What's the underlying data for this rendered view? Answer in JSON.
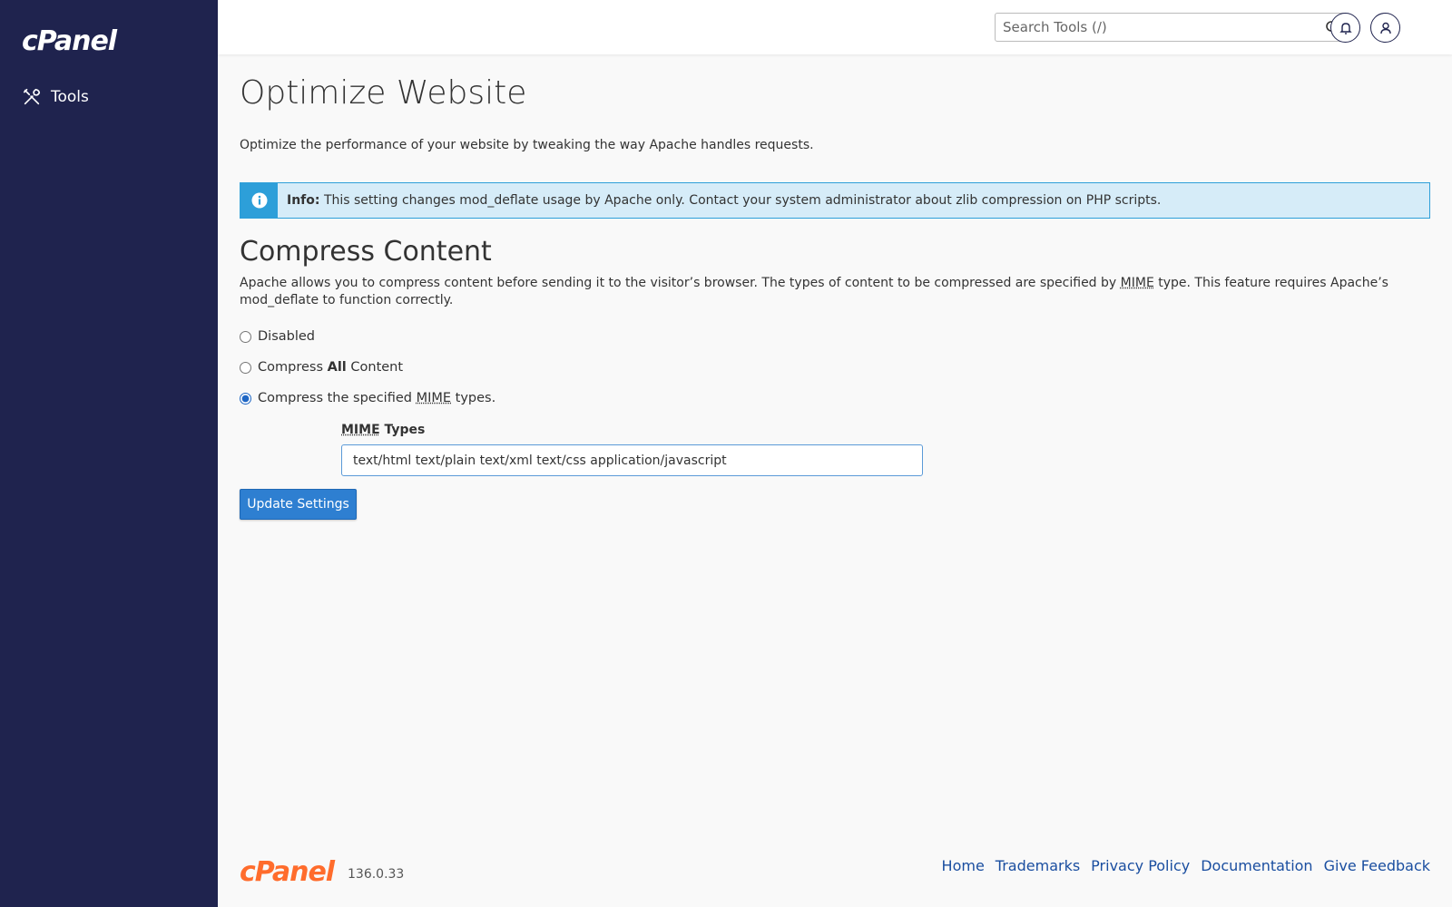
{
  "sidebar": {
    "logo_text": "cPanel",
    "nav": [
      {
        "label": "Tools",
        "icon": "tools-icon"
      }
    ]
  },
  "topbar": {
    "search_placeholder": "Search Tools (/)",
    "search_value": "",
    "icons": [
      "search-icon",
      "bell-icon",
      "user-icon"
    ]
  },
  "page": {
    "title": "Optimize Website",
    "description": "Optimize the performance of your website by tweaking the way Apache handles requests."
  },
  "info": {
    "label": "Info:",
    "text": "This setting changes mod_deflate usage by Apache only. Contact your system administrator about zlib compression on PHP scripts."
  },
  "compress": {
    "title": "Compress Content",
    "desc_part1": "Apache allows you to compress content before sending it to the visitor’s browser. The types of content to be compressed are specified by ",
    "desc_abbr": "MIME",
    "desc_part2": " type. This feature requires Apache’s mod_deflate to function correctly.",
    "options": {
      "disabled": "Disabled",
      "all_prefix": "Compress ",
      "all_bold": "All",
      "all_suffix": " Content",
      "specified_prefix": "Compress the specified ",
      "specified_abbr": "MIME",
      "specified_suffix": " types."
    },
    "selected": "specified",
    "mime_label_abbr": "MIME",
    "mime_label_suffix": " Types",
    "mime_value": "text/html text/plain text/xml text/css application/javascript",
    "update_button": "Update Settings"
  },
  "footer": {
    "logo_text": "cPanel",
    "version": "136.0.33",
    "links": [
      "Home",
      "Trademarks",
      "Privacy Policy",
      "Documentation",
      "Give Feedback"
    ]
  },
  "colors": {
    "sidebar_bg": "#1f234e",
    "accent_blue": "#2e7fd1",
    "info_blue": "#2d9fd9",
    "brand_orange": "#ff6c2c"
  }
}
